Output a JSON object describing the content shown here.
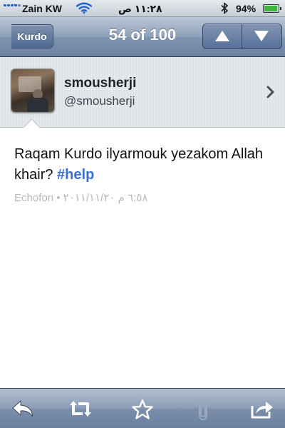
{
  "status_bar": {
    "carrier": "Zain KW",
    "time": "١١:٢٨ ص",
    "battery_percent": "94%",
    "battery_level": 0.94,
    "signal_icon": "signal-bars-icon",
    "wifi_icon": "wifi-icon",
    "bluetooth_icon": "bluetooth-icon"
  },
  "nav": {
    "back_label": "Kurdo",
    "title": "54 of 100",
    "prev_icon": "up-arrow-icon",
    "next_icon": "down-arrow-icon"
  },
  "profile": {
    "display_name": "smousherji",
    "handle": "@smousherji"
  },
  "tweet": {
    "text": "Raqam Kurdo ilyarmouk yezakom Allah khair?",
    "hashtag": "#help",
    "meta": "Echofon • ٦:٥٨ م ٢٠١١/١١/٢٠"
  },
  "toolbar": {
    "icons": [
      "reply-icon",
      "retweet-icon",
      "favorite-star-icon",
      "attachment-paperclip-icon",
      "share-icon"
    ]
  },
  "colors": {
    "hashtag": "#3a6fd1",
    "nav_bar": "#7f93ae",
    "meta_text": "#b5b9be"
  }
}
